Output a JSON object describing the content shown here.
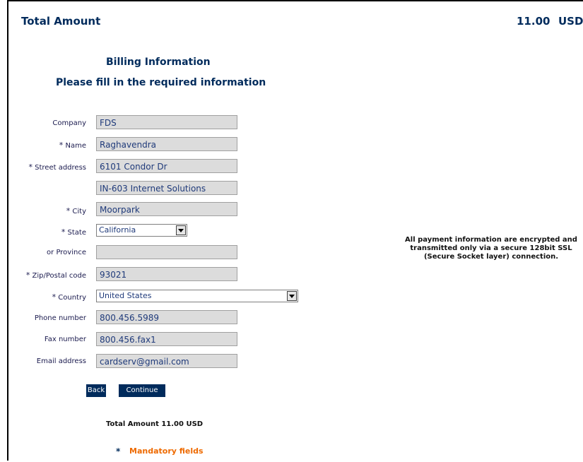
{
  "header": {
    "total_label": "Total Amount",
    "total_amount": "11.00",
    "currency": "USD"
  },
  "billing": {
    "title": "Billing Information",
    "instruction": "Please fill in the required information"
  },
  "form": {
    "company": {
      "label": "Company",
      "value": "FDS"
    },
    "name": {
      "label": "Name",
      "value": "Raghavendra"
    },
    "street": {
      "label": "Street address",
      "value": "6101 Condor Dr"
    },
    "street2": {
      "value": "IN-603 Internet Solutions"
    },
    "city": {
      "label": "City",
      "value": "Moorpark"
    },
    "state": {
      "label": "State",
      "value": "California"
    },
    "province": {
      "label": "or Province",
      "value": ""
    },
    "zip": {
      "label": "Zip/Postal code",
      "value": "93021"
    },
    "country": {
      "label": "Country",
      "value": "United States"
    },
    "phone": {
      "label": "Phone number",
      "value": "800.456.5989"
    },
    "fax": {
      "label": "Fax number",
      "value": "800.456.fax1"
    },
    "email": {
      "label": "Email address",
      "value": "cardserv@gmail.com"
    },
    "required_marker": "*"
  },
  "buttons": {
    "back": "Back",
    "continue": "Continue"
  },
  "footer": {
    "total_text": "Total Amount  11.00 USD",
    "mandatory_marker": "*",
    "mandatory_label": "Mandatory fields"
  },
  "security_note": "All payment information are encrypted and transmitted only via a secure 128bit SSL (Secure Socket layer) connection.",
  "colors": {
    "navy": "#002b5c",
    "field_bg": "#dcdcdc",
    "accent_orange": "#ee6a00"
  }
}
